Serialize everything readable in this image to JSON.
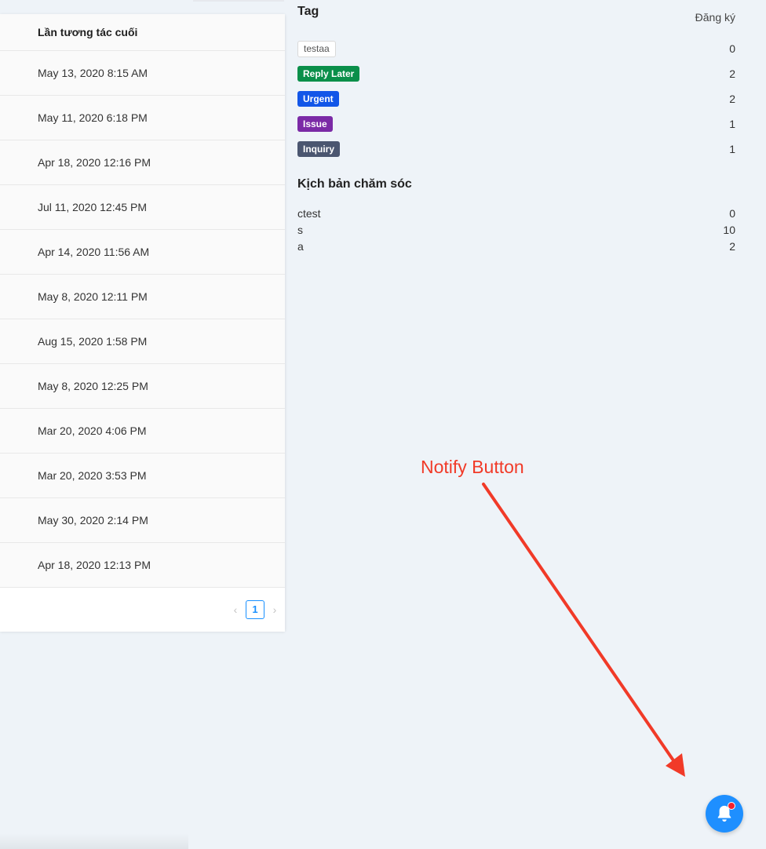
{
  "table": {
    "header": "Lần tương tác cuối",
    "rows": [
      "May 13, 2020 8:15 AM",
      "May 11, 2020 6:18 PM",
      "Apr 18, 2020 12:16 PM",
      "Jul 11, 2020 12:45 PM",
      "Apr 14, 2020 11:56 AM",
      "May 8, 2020 12:11 PM",
      "Aug 15, 2020 1:58 PM",
      "May 8, 2020 12:25 PM",
      "Mar 20, 2020 4:06 PM",
      "Mar 20, 2020 3:53 PM",
      "May 30, 2020 2:14 PM",
      "Apr 18, 2020 12:13 PM"
    ],
    "pagination": {
      "prev": "‹",
      "current": "1",
      "next": "›"
    }
  },
  "tags": {
    "title": "Tag",
    "count_label": "Đăng ký",
    "items": [
      {
        "label": "testaa",
        "count": "0",
        "color": "#ffffff",
        "style": "outline"
      },
      {
        "label": "Reply Later",
        "count": "2",
        "color": "#0a8f4a",
        "style": "solid"
      },
      {
        "label": "Urgent",
        "count": "2",
        "color": "#1256e8",
        "style": "solid"
      },
      {
        "label": "Issue",
        "count": "1",
        "color": "#7b2aa6",
        "style": "solid"
      },
      {
        "label": "Inquiry",
        "count": "1",
        "color": "#4b5670",
        "style": "solid"
      }
    ]
  },
  "care": {
    "title": "Kịch bản chăm sóc",
    "items": [
      {
        "label": "ctest",
        "count": "0"
      },
      {
        "label": "s",
        "count": "10"
      },
      {
        "label": "a",
        "count": "2"
      }
    ]
  },
  "annotation": {
    "text": "Notify Button",
    "color": "#f13a28"
  },
  "notify": {
    "icon": "bell-icon",
    "color": "#1e8fff",
    "badge_color": "#f5222d"
  }
}
